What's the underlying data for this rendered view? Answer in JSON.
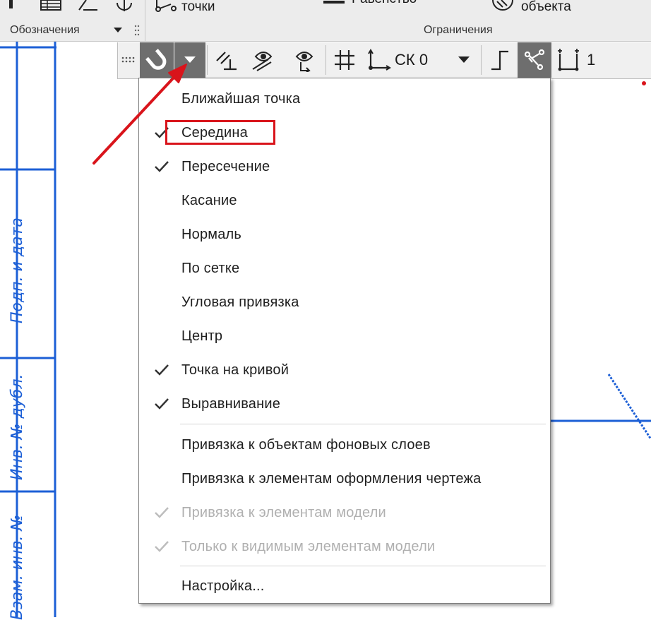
{
  "ribbon": {
    "points_label": "точки",
    "equality_label": "Равенство",
    "object_label": "объекта",
    "designations_caption": "Обозначения",
    "constraints_caption": "Ограничения"
  },
  "snap_toolbar": {
    "coord_system_label": "СК 0",
    "count_label": "1"
  },
  "frame": {
    "sig_date_label": "Подп. и дата",
    "inv_dup_label": "Инв. № дубл.",
    "vzam_inv_label": "Взам. инв. №"
  },
  "snap_menu": {
    "items": [
      {
        "label": "Ближайшая точка",
        "checked": false,
        "disabled": false
      },
      {
        "label": "Середина",
        "checked": true,
        "disabled": false
      },
      {
        "label": "Пересечение",
        "checked": true,
        "disabled": false
      },
      {
        "label": "Касание",
        "checked": false,
        "disabled": false
      },
      {
        "label": "Нормаль",
        "checked": false,
        "disabled": false
      },
      {
        "label": "По сетке",
        "checked": false,
        "disabled": false
      },
      {
        "label": "Угловая привязка",
        "checked": false,
        "disabled": false
      },
      {
        "label": "Центр",
        "checked": false,
        "disabled": false
      },
      {
        "label": "Точка на кривой",
        "checked": true,
        "disabled": false
      },
      {
        "label": "Выравнивание",
        "checked": true,
        "disabled": false
      },
      {
        "label": "Привязка к объектам фоновых слоев",
        "checked": false,
        "disabled": false
      },
      {
        "label": "Привязка к элементам оформления чертежа",
        "checked": false,
        "disabled": false
      },
      {
        "label": "Привязка к элементам модели",
        "checked": true,
        "disabled": true
      },
      {
        "label": "Только к видимым элементам модели",
        "checked": true,
        "disabled": true
      },
      {
        "label": "Настройка...",
        "checked": false,
        "disabled": false
      }
    ]
  },
  "colors": {
    "frame_blue": "#1c5fd6",
    "annotation_red": "#d9141b",
    "toolbar_active": "#6e6e6e"
  }
}
